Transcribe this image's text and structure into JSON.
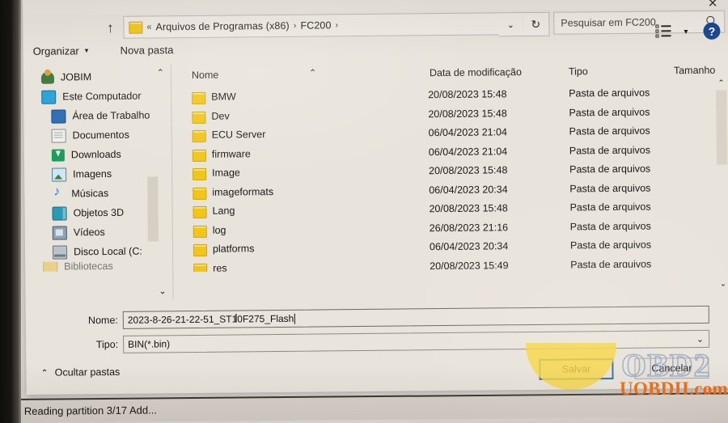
{
  "window": {
    "close_label": "✕"
  },
  "nav": {
    "up_label": "↑",
    "breadcrumb_prefix": "«",
    "breadcrumb_parts": [
      "Arquivos de Programas (x86)",
      "FC200"
    ],
    "breadcrumb_sep": "›",
    "dropdown_label": "⌄",
    "refresh_label": "↻"
  },
  "search": {
    "placeholder": "Pesquisar em FC200"
  },
  "toolbar": {
    "organize_label": "Organizar",
    "organize_caret": "▾",
    "new_folder_label": "Nova pasta",
    "view_caret": "▾",
    "help_label": "?"
  },
  "sidebar": {
    "scroll_up": "⌃",
    "scroll_down": "⌄",
    "collapse": "‹",
    "items": [
      {
        "label": "JOBIM",
        "icon": "user-icon",
        "indent": false
      },
      {
        "label": "Este Computador",
        "icon": "computer-icon",
        "indent": false
      },
      {
        "label": "Área de Trabalho",
        "icon": "desktop-icon",
        "indent": true
      },
      {
        "label": "Documentos",
        "icon": "documents-icon",
        "indent": true
      },
      {
        "label": "Downloads",
        "icon": "downloads-icon",
        "indent": true
      },
      {
        "label": "Imagens",
        "icon": "pictures-icon",
        "indent": true
      },
      {
        "label": "Músicas",
        "icon": "music-icon",
        "indent": true
      },
      {
        "label": "Objetos 3D",
        "icon": "objects3d-icon",
        "indent": true
      },
      {
        "label": "Vídeos",
        "icon": "videos-icon",
        "indent": true
      },
      {
        "label": "Disco Local (C:",
        "icon": "disk-icon",
        "indent": true
      },
      {
        "label": "Bibliotecas",
        "icon": "library-icon",
        "indent": false
      }
    ]
  },
  "filelist": {
    "columns": {
      "name": "Nome",
      "modified": "Data de modificação",
      "type": "Tipo",
      "size": "Tamanho"
    },
    "sort_indicator": "⌃",
    "scroll_up": "⌃",
    "scroll_down": "⌄",
    "rows": [
      {
        "name": "BMW",
        "modified": "20/08/2023 15:48",
        "type": "Pasta de arquivos",
        "size": ""
      },
      {
        "name": "Dev",
        "modified": "20/08/2023 15:48",
        "type": "Pasta de arquivos",
        "size": ""
      },
      {
        "name": "ECU Server",
        "modified": "06/04/2023 21:04",
        "type": "Pasta de arquivos",
        "size": ""
      },
      {
        "name": "firmware",
        "modified": "06/04/2023 21:04",
        "type": "Pasta de arquivos",
        "size": ""
      },
      {
        "name": "Image",
        "modified": "20/08/2023 15:48",
        "type": "Pasta de arquivos",
        "size": ""
      },
      {
        "name": "imageformats",
        "modified": "06/04/2023 20:34",
        "type": "Pasta de arquivos",
        "size": ""
      },
      {
        "name": "Lang",
        "modified": "20/08/2023 15:48",
        "type": "Pasta de arquivos",
        "size": ""
      },
      {
        "name": "log",
        "modified": "26/08/2023 21:16",
        "type": "Pasta de arquivos",
        "size": ""
      },
      {
        "name": "platforms",
        "modified": "06/04/2023 20:34",
        "type": "Pasta de arquivos",
        "size": ""
      },
      {
        "name": "res",
        "modified": "20/08/2023 15:49",
        "type": "Pasta de arquivos",
        "size": ""
      }
    ]
  },
  "form": {
    "name_label": "Nome:",
    "name_value": "2023-8-26-21-22-51_ST10F275_Flash",
    "type_label": "Tipo:",
    "type_value": "BIN(*.bin)",
    "type_arrow": "⌄",
    "hide_folders_label": "Ocultar pastas",
    "hide_folders_chevron": "⌃",
    "save_label": "Salvar",
    "cancel_label": "Cancelar"
  },
  "status": {
    "text": "Reading partition 3/17 Add..."
  },
  "watermark": {
    "brand_top": "OBD2",
    "brand_bottom": "UOBDII.com"
  },
  "colors": {
    "folder_yellow": "#f2c516",
    "help_blue": "#1b4a94",
    "focus_blue": "#2f6aa8",
    "watermark_orange": "#f4690d",
    "watermark_blue": "#8fa6c4",
    "watermark_yellow": "#f6d43c"
  }
}
